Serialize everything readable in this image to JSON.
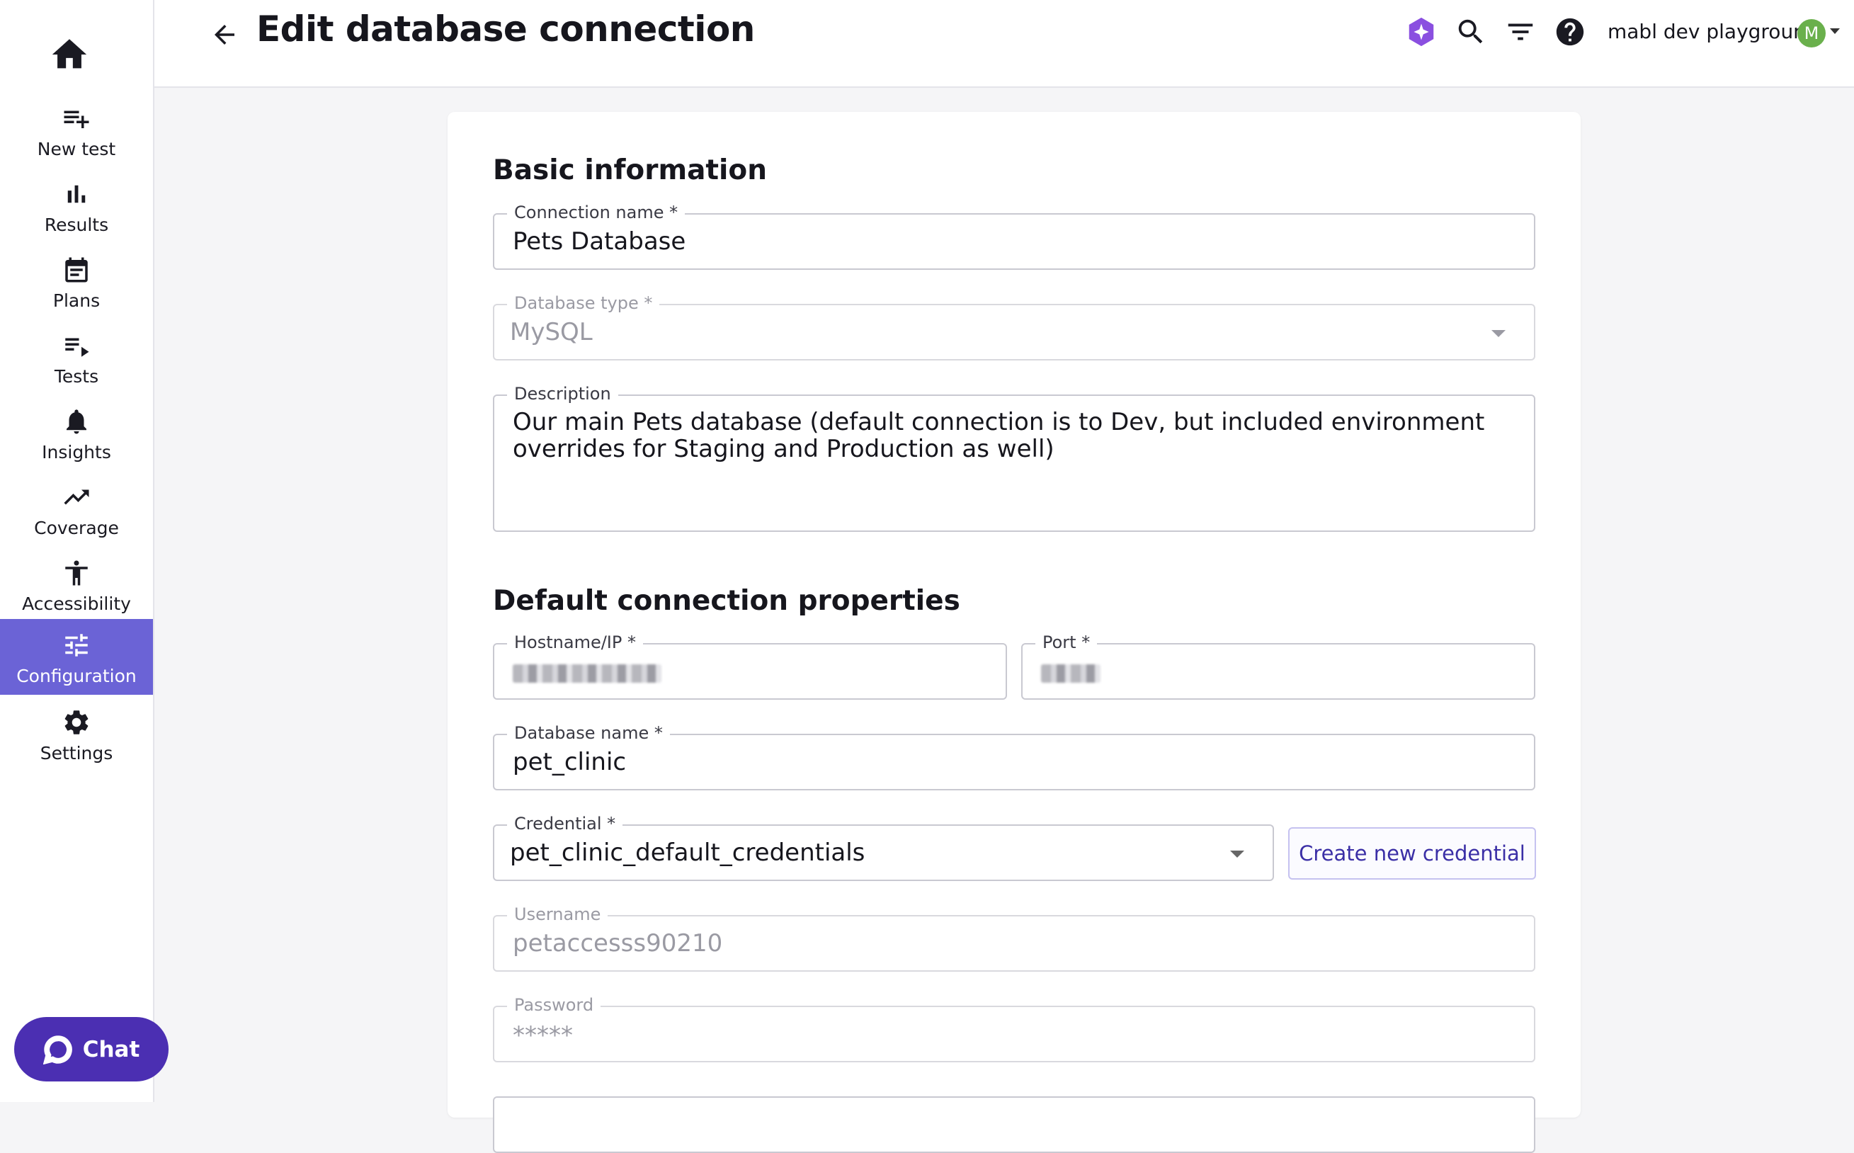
{
  "sidebar": {
    "items": [
      {
        "label": "New test",
        "icon": "playlist-add-icon"
      },
      {
        "label": "Results",
        "icon": "bar-chart-icon"
      },
      {
        "label": "Plans",
        "icon": "calendar-icon"
      },
      {
        "label": "Tests",
        "icon": "playlist-play-icon"
      },
      {
        "label": "Insights",
        "icon": "bell-icon"
      },
      {
        "label": "Coverage",
        "icon": "trending-up-icon"
      },
      {
        "label": "Accessibility",
        "icon": "accessibility-icon"
      },
      {
        "label": "Configuration",
        "icon": "tune-icon"
      },
      {
        "label": "Settings",
        "icon": "gear-icon"
      }
    ],
    "active": "Configuration",
    "chat_label": "Chat"
  },
  "header": {
    "title": "Edit database connection",
    "workspace": "mabl dev playground",
    "avatar_initial": "M"
  },
  "form": {
    "basic": {
      "title": "Basic information",
      "connection_name_label": "Connection name *",
      "connection_name": "Pets Database",
      "db_type_label": "Database type *",
      "db_type": "MySQL",
      "description_label": "Description",
      "description": "Our main Pets database (default connection is to Dev, but included environment overrides for Staging and Production as well)"
    },
    "defaults": {
      "title": "Default connection properties",
      "hostname_label": "Hostname/IP *",
      "port_label": "Port *",
      "db_name_label": "Database name *",
      "db_name": "pet_clinic",
      "credential_label": "Credential *",
      "credential": "pet_clinic_default_credentials",
      "create_credential": "Create new credential",
      "username_label": "Username",
      "username": "petaccesss90210",
      "password_label": "Password",
      "password": "*****"
    }
  },
  "colors": {
    "accent": "#6b63d6",
    "chat": "#4b2fb2",
    "avatar": "#6ab04c"
  }
}
